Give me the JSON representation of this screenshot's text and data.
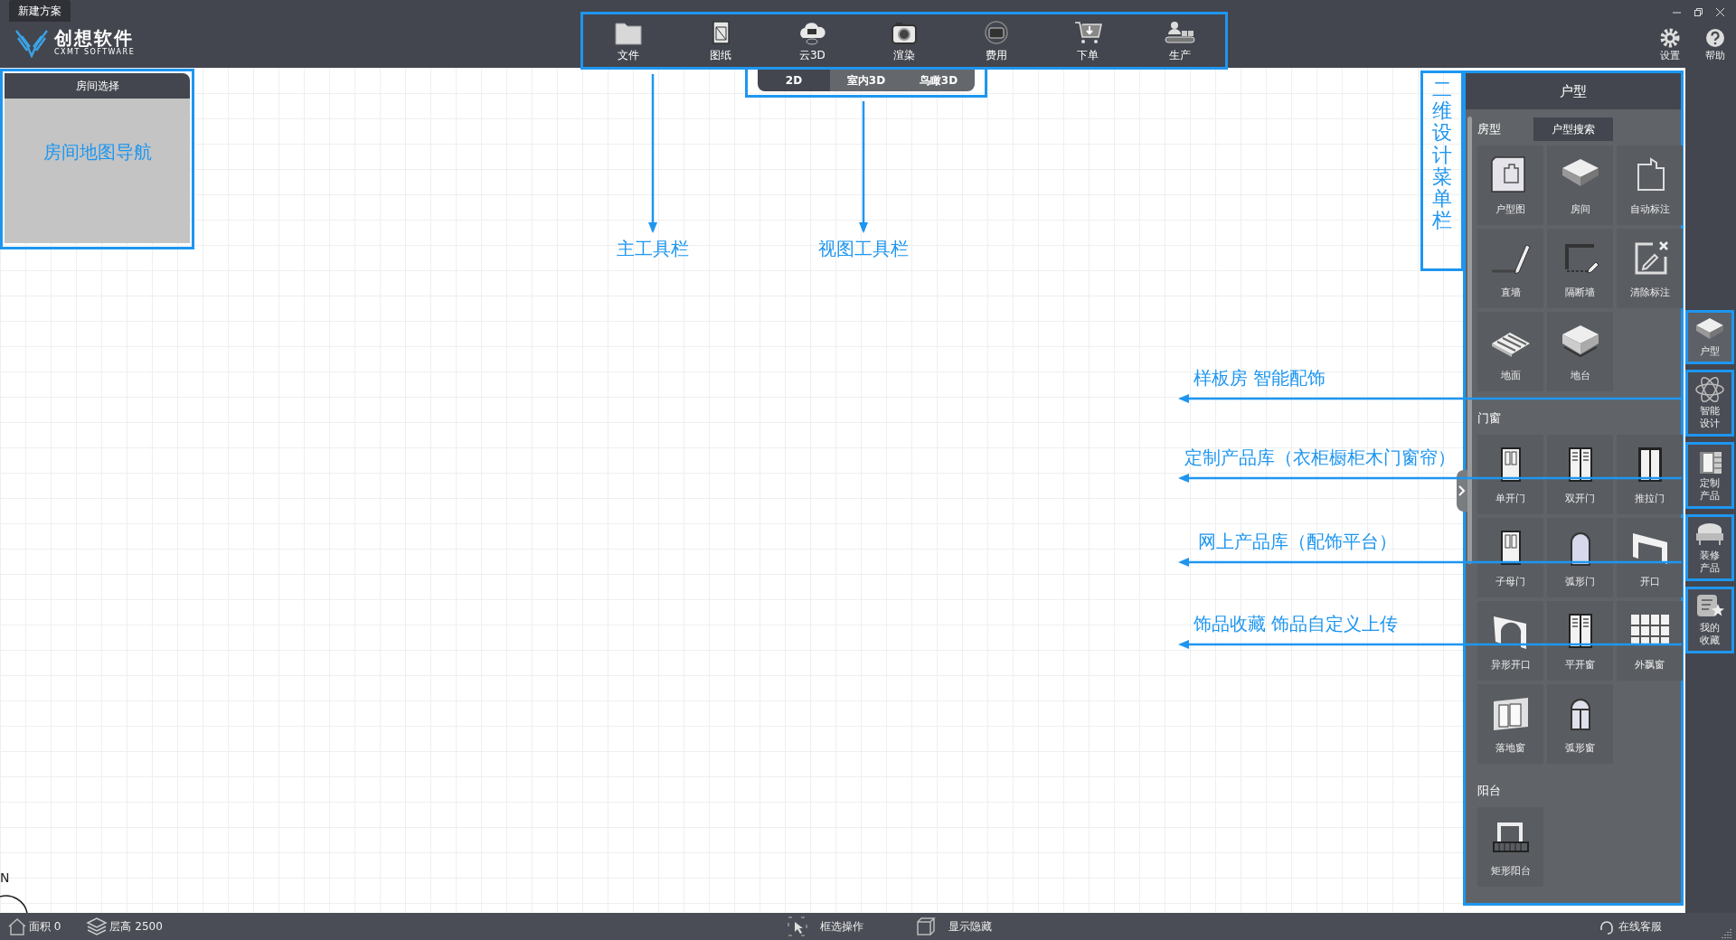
{
  "title_tab": "新建方案",
  "logo": {
    "name": "创想软件",
    "subtitle": "CXMT SOFTWARE"
  },
  "main_toolbar": [
    {
      "label": "文件"
    },
    {
      "label": "图纸"
    },
    {
      "label": "云3D"
    },
    {
      "label": "渲染"
    },
    {
      "label": "费用"
    },
    {
      "label": "下单"
    },
    {
      "label": "生产"
    }
  ],
  "header_buttons": [
    {
      "label": "设置"
    },
    {
      "label": "帮助"
    }
  ],
  "view_toolbar": [
    {
      "label": "2D",
      "selected": true
    },
    {
      "label": "室内3D",
      "selected": false
    },
    {
      "label": "鸟瞰3D",
      "selected": false
    }
  ],
  "room_panel": {
    "title": "房间选择",
    "content": "房间地图导航"
  },
  "design_panel": {
    "title": "户型",
    "sections": [
      {
        "title": "房型",
        "search_button": "户型搜索",
        "items": [
          "户型图",
          "房间",
          "自动标注",
          "直墙",
          "隔断墙",
          "清除标注",
          "地面",
          "地台"
        ]
      },
      {
        "title": "门窗",
        "items": [
          "单开门",
          "双开门",
          "推拉门",
          "子母门",
          "弧形门",
          "开口",
          "异形开口",
          "平开窗",
          "外飘窗",
          "落地窗",
          "弧形窗"
        ]
      },
      {
        "title": "阳台",
        "items": [
          "矩形阳台"
        ]
      }
    ]
  },
  "side_tabs": [
    {
      "label": "户型",
      "selected": true
    },
    {
      "label": "智能设计",
      "selected": false
    },
    {
      "label": "定制产品",
      "selected": false
    },
    {
      "label": "装修产品",
      "selected": false
    },
    {
      "label": "我的收藏",
      "selected": false
    }
  ],
  "annotations": {
    "toolbar_labels": [
      "主工具栏",
      "视图工具栏"
    ],
    "menu_label": "二维设计菜单栏",
    "side_notes": [
      "样板房 智能配饰",
      "定制产品库（衣柜橱柜木门窗帘）",
      "网上产品库（配饰平台）",
      "饰品收藏 饰品自定义上传"
    ]
  },
  "compass": "N",
  "status_bar": {
    "area": "面积 0",
    "floor_height": "层高 2500",
    "box_select": "框选操作",
    "show_hide": "显示隐藏",
    "support": "在线客服"
  }
}
